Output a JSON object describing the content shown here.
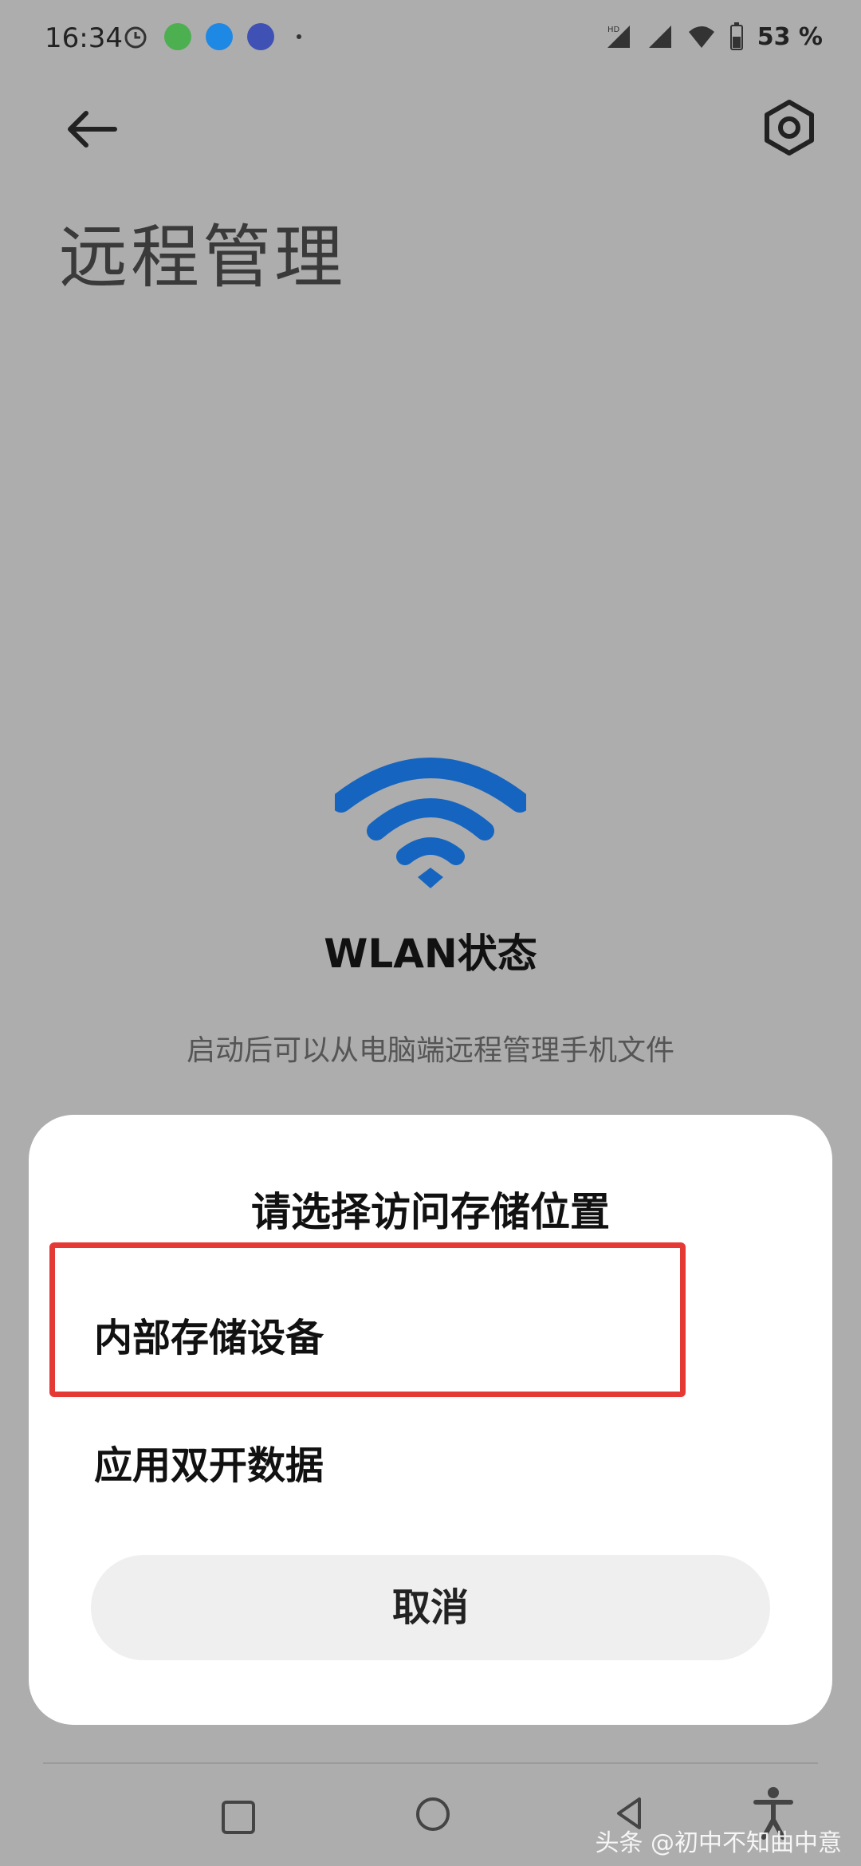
{
  "status_bar": {
    "time": "16:34",
    "battery": "53 %",
    "icons": [
      "alarm-icon",
      "wechat-icon",
      "browser-icon",
      "tiebar-icon",
      "dot-icon",
      "hd-signal-icon",
      "signal-icon",
      "wifi-icon",
      "battery-icon"
    ]
  },
  "header": {
    "back_icon": "arrow-left-icon",
    "settings_icon": "hex-gear-icon",
    "title": "远程管理"
  },
  "hero": {
    "icon": "wifi-icon",
    "status_label": "WLAN状态",
    "description": "启动后可以从电脑端远程管理手机文件",
    "accent_color": "#1565c0"
  },
  "dialog": {
    "title": "请选择访问存储位置",
    "options": [
      {
        "label": "内部存储设备",
        "highlighted": true
      },
      {
        "label": "应用双开数据",
        "highlighted": false
      }
    ],
    "cancel_label": "取消",
    "highlight_color": "#e53935"
  },
  "nav_bar": {
    "icons": [
      "recent-apps-square-icon",
      "home-circle-icon",
      "back-triangle-icon",
      "accessibility-icon"
    ]
  },
  "watermark": "头条 @初中不知曲中意"
}
